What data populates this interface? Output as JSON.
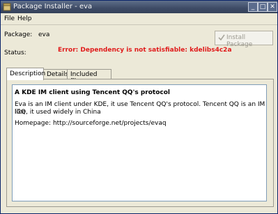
{
  "window": {
    "title": "Package Installer - eva",
    "minimize_label": "_",
    "maximize_label": "□",
    "close_label": "✕"
  },
  "menu": {
    "file": "File",
    "help": "Help"
  },
  "package": {
    "label": "Package:",
    "value": "eva",
    "status_label": "Status:",
    "status_error": "Error: Dependency is not satisfiable: kdelibs4c2a",
    "install_button": "Install Package"
  },
  "tabs": [
    {
      "label": "Description"
    },
    {
      "label": "Details"
    },
    {
      "label": "Included files"
    }
  ],
  "description": {
    "title": "A KDE IM client using Tencent QQ's protocol",
    "line1": "Eva is an IM client under KDE, it use Tencent QQ's protocol. Tencent QQ is an IM like",
    "line2": "ICQ, it used widely in China",
    "homepage": "Homepage: http://sourceforge.net/projects/evaq"
  },
  "colors": {
    "error": "#e01b1b",
    "titlebar": "#3e4b66"
  }
}
